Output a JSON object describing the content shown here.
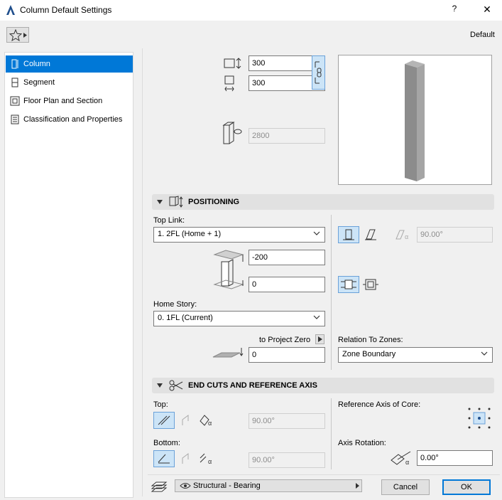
{
  "window": {
    "title": "Column Default Settings",
    "help": "?",
    "close": "✕"
  },
  "favorites": {
    "label": "Default"
  },
  "sidebar": {
    "items": [
      {
        "label": "Column",
        "selected": true
      },
      {
        "label": "Segment"
      },
      {
        "label": "Floor Plan and Section"
      },
      {
        "label": "Classification and Properties"
      }
    ]
  },
  "geometry": {
    "width": "300",
    "depth": "300",
    "height": "2800"
  },
  "positioning": {
    "header": "POSITIONING",
    "top_link_label": "Top Link:",
    "top_link_value": "1. 2FL (Home + 1)",
    "top_offset": "-200",
    "bottom_offset": "0",
    "home_story_label": "Home Story:",
    "home_story_value": "0. 1FL (Current)",
    "project_zero_label": "to Project Zero",
    "project_zero_value": "0",
    "angle_value": "90.00°",
    "relation_label": "Relation To Zones:",
    "relation_value": "Zone Boundary"
  },
  "endcuts": {
    "header": "END CUTS AND REFERENCE AXIS",
    "top_label": "Top:",
    "top_angle": "90.00°",
    "bottom_label": "Bottom:",
    "bottom_angle": "90.00°",
    "ref_axis_label": "Reference Axis of Core:",
    "axis_rotation_label": "Axis Rotation:",
    "axis_rotation_value": "0.00°"
  },
  "footer": {
    "structural": "Structural - Bearing",
    "cancel": "Cancel",
    "ok": "OK"
  },
  "colors": {
    "accent": "#0078d7",
    "toggle_on": "#cce4f7",
    "column_gray": "#8c8c8c"
  }
}
